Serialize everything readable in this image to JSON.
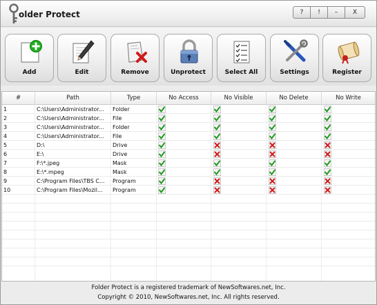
{
  "window": {
    "title": "older Protect",
    "controls": [
      {
        "name": "help-button",
        "label": "?"
      },
      {
        "name": "info-button",
        "label": "!"
      },
      {
        "name": "minimize-button",
        "label": "–"
      },
      {
        "name": "close-button",
        "label": "X"
      }
    ]
  },
  "toolbar": {
    "buttons": [
      {
        "name": "add-button",
        "icon": "add-document-icon",
        "label": "Add"
      },
      {
        "name": "edit-button",
        "icon": "pencil-icon",
        "label": "Edit"
      },
      {
        "name": "remove-button",
        "icon": "remove-icon",
        "label": "Remove"
      },
      {
        "name": "unprotect-button",
        "icon": "padlock-icon",
        "label": "Unprotect"
      },
      {
        "name": "select-all-button",
        "icon": "checklist-icon",
        "label": "Select All"
      },
      {
        "name": "settings-button",
        "icon": "tools-icon",
        "label": "Settings"
      },
      {
        "name": "register-button",
        "icon": "scroll-icon",
        "label": "Register"
      }
    ]
  },
  "grid": {
    "columns": [
      "#",
      "Path",
      "Type",
      "No Access",
      "No Visible",
      "No Delete",
      "No Write"
    ],
    "rows": [
      {
        "num": "1",
        "path": "C:\\Users\\Administrator...",
        "type": "Folder",
        "access": true,
        "visible": true,
        "delete": true,
        "write": true
      },
      {
        "num": "2",
        "path": "C:\\Users\\Administrator...",
        "type": "File",
        "access": true,
        "visible": true,
        "delete": true,
        "write": true
      },
      {
        "num": "3",
        "path": "C:\\Users\\Administrator...",
        "type": "Folder",
        "access": true,
        "visible": true,
        "delete": true,
        "write": true
      },
      {
        "num": "4",
        "path": "C:\\Users\\Administrator...",
        "type": "File",
        "access": true,
        "visible": true,
        "delete": true,
        "write": true
      },
      {
        "num": "5",
        "path": "D:\\",
        "type": "Drive",
        "access": true,
        "visible": false,
        "delete": false,
        "write": false
      },
      {
        "num": "6",
        "path": "E:\\",
        "type": "Drive",
        "access": true,
        "visible": false,
        "delete": false,
        "write": false
      },
      {
        "num": "7",
        "path": "F:\\*.jpeg",
        "type": "Mask",
        "access": true,
        "visible": true,
        "delete": true,
        "write": true
      },
      {
        "num": "8",
        "path": "E:\\*.mpeg",
        "type": "Mask",
        "access": true,
        "visible": true,
        "delete": true,
        "write": true
      },
      {
        "num": "9",
        "path": "C:\\Program Files\\TBS C...",
        "type": "Program",
        "access": true,
        "visible": false,
        "delete": false,
        "write": false
      },
      {
        "num": "10",
        "path": "C:\\Program Files\\Mozil...",
        "type": "Program",
        "access": true,
        "visible": false,
        "delete": false,
        "write": false
      }
    ]
  },
  "footer": {
    "line1": "Folder Protect is a registered trademark of NewSoftwares.net, Inc.",
    "line2": "Copyright © 2010, NewSoftwares.net, Inc. All rights reserved."
  },
  "colors": {
    "check": "#1e9a1e",
    "cross": "#d21a1a",
    "add_badge": "#1fae1f"
  }
}
